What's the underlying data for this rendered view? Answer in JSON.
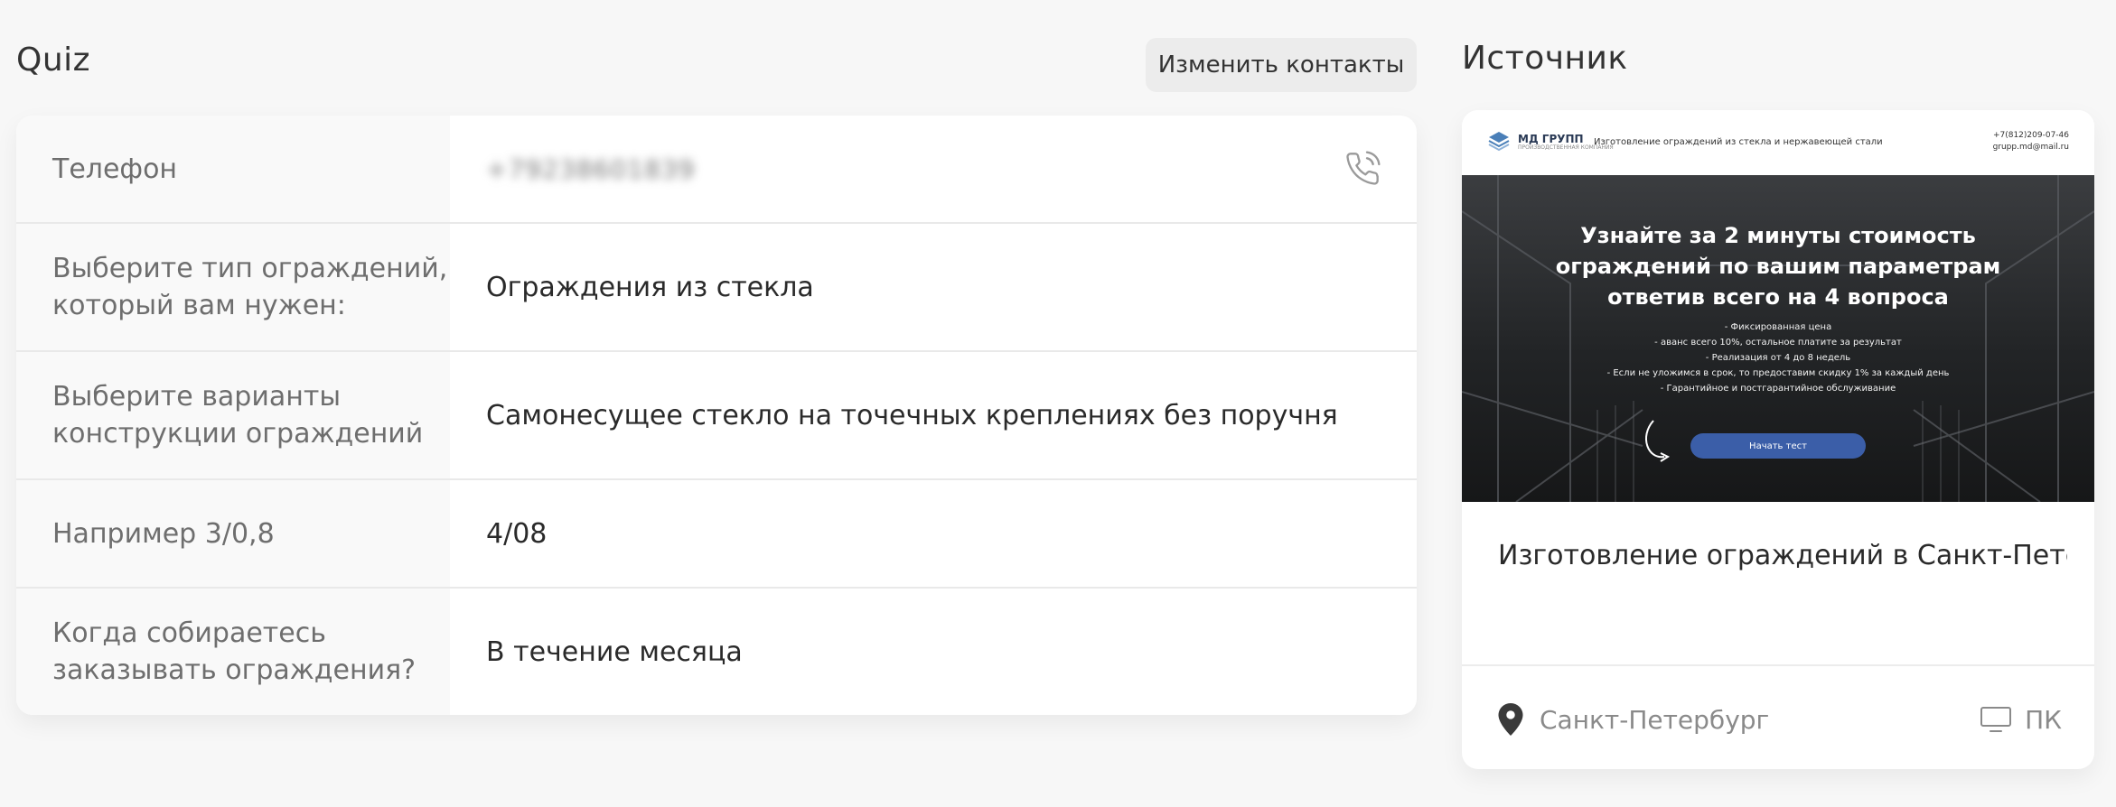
{
  "quiz": {
    "title": "Quiz",
    "change_contacts_label": "Изменить контакты",
    "rows": [
      {
        "label": "Телефон",
        "value": "+79238601839"
      },
      {
        "label": "Выберите тип ограждений, который вам нужен:",
        "value": "Ограждения из стекла"
      },
      {
        "label": "Выберите варианты конструкции ограждений",
        "value": "Самонесущее стекло на точечных креплениях без поручня"
      },
      {
        "label": "Например 3/0,8",
        "value": "4/08"
      },
      {
        "label": "Когда собираетесь заказывать ограждения?",
        "value": "В течение месяца"
      }
    ]
  },
  "source": {
    "title": "Источник",
    "name": "Изготовление ограждений в Санкт-Пете...",
    "location": "Санкт-Петербург",
    "device": "ПК",
    "preview": {
      "logo_name": "МД ГРУПП",
      "logo_sub": "ПРОИЗВОДСТВЕННАЯ КОМПАНИЯ",
      "tagline": "Изготовление ограждений из стекла и нержавеющей стали",
      "phone": "+7(812)209-07-46",
      "email": "grupp.md@mail.ru",
      "headline_1": "Узнайте за 2 минуты стоимость",
      "headline_2": "ограждений по вашим параметрам",
      "headline_3": "ответив всего на 4 вопроса",
      "bullet_1": "- Фиксированная цена",
      "bullet_2": "- аванс всего 10%, остальное платите за результат",
      "bullet_3": "- Реализация от 4 до 8 недель",
      "bullet_4": "- Если не уложимся в срок, то предоставим скидку 1% за каждый день",
      "bullet_5": "- Гарантийное и постгарантийное обслуживание",
      "cta": "Начать тест"
    }
  },
  "colors": {
    "background": "#f7f7f7",
    "card": "#ffffff",
    "label_column": "#f9f9f9",
    "button": "#ececec",
    "cta_blue": "#3b5ea8"
  },
  "icons": [
    "phone-icon",
    "location-pin-icon",
    "desktop-icon"
  ]
}
